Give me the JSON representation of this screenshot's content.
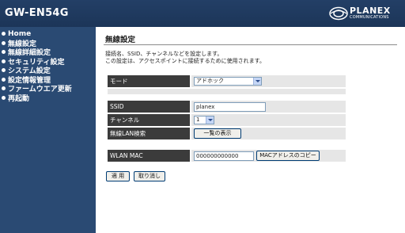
{
  "header": {
    "product": "GW-EN54G",
    "brand": "PLANEX",
    "brand_sub": "COMMUNICATIONS"
  },
  "sidebar": {
    "items": [
      {
        "label": "Home"
      },
      {
        "label": "無線設定"
      },
      {
        "label": "無線詳細設定"
      },
      {
        "label": "セキュリティ設定"
      },
      {
        "label": "システム設定"
      },
      {
        "label": "設定情報管理"
      },
      {
        "label": "ファームウエア更新"
      },
      {
        "label": "再起動"
      }
    ]
  },
  "main": {
    "title": "無線設定",
    "description": [
      "接続名、SSID、チャンネルなどを設定します。",
      "この設定は、アクセスポイントに接続するために使用されます。"
    ],
    "mode": {
      "label": "モード",
      "value": "アドホック"
    },
    "ssid": {
      "label": "SSID",
      "value": "planex"
    },
    "channel": {
      "label": "チャンネル",
      "value": "1"
    },
    "scan": {
      "label": "無線LAN検索",
      "button": "一覧の表示"
    },
    "wlan_mac": {
      "label": "WLAN MAC",
      "value": "000000000000",
      "button": "MACアドレスのコピー"
    },
    "apply_button": "適 用",
    "cancel_button": "取り消し"
  },
  "colors": {
    "header_bg": "#1c3558",
    "sidebar_bg": "#2a4a73",
    "label_bg": "#3b3b3b",
    "value_bg": "#e6e6e6"
  }
}
